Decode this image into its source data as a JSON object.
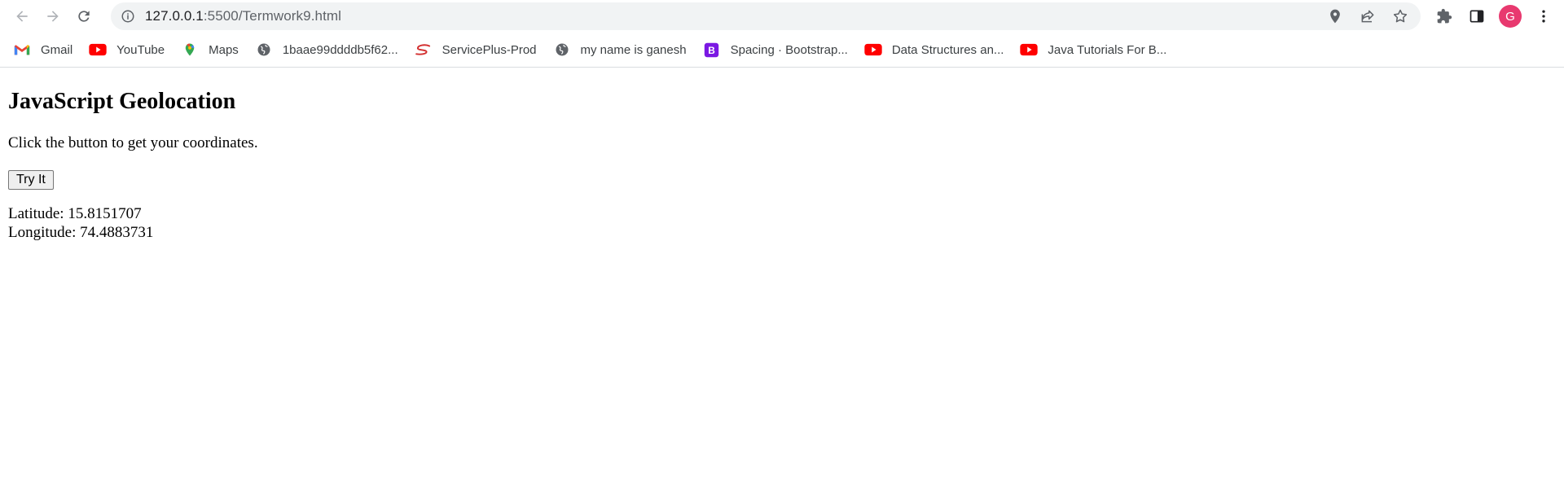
{
  "browser": {
    "url_host": "127.0.0.1",
    "url_path": ":5500/Termwork9.html",
    "avatar_letter": "G"
  },
  "bookmarks": [
    {
      "label": "Gmail",
      "icon": "gmail-icon"
    },
    {
      "label": "YouTube",
      "icon": "youtube-icon"
    },
    {
      "label": "Maps",
      "icon": "maps-icon"
    },
    {
      "label": "1baae99ddddb5f62...",
      "icon": "globe-icon"
    },
    {
      "label": "ServicePlus-Prod",
      "icon": "serviceplus-icon"
    },
    {
      "label": "my name is ganesh",
      "icon": "globe-icon"
    },
    {
      "label": "Spacing · Bootstrap...",
      "icon": "bootstrap-icon"
    },
    {
      "label": "Data Structures an...",
      "icon": "youtube-icon"
    },
    {
      "label": "Java Tutorials For B...",
      "icon": "youtube-icon"
    }
  ],
  "page": {
    "heading": "JavaScript Geolocation",
    "instruction": "Click the button to get your coordinates.",
    "button_label": "Try It",
    "latitude_label": "Latitude: 15.8151707",
    "longitude_label": "Longitude: 74.4883731"
  },
  "colors": {
    "avatar": "#e8396f",
    "youtube": "#ff0000",
    "bootstrap": "#7952b3"
  }
}
